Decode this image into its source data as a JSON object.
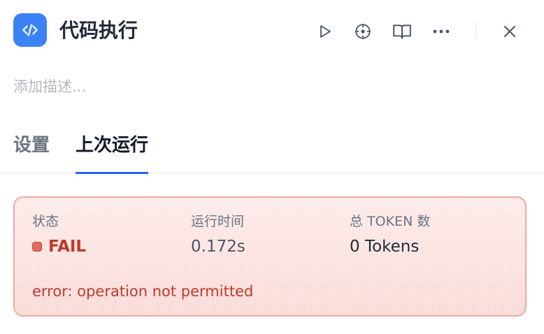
{
  "header": {
    "title": "代码执行",
    "icon": "code-icon",
    "actions": [
      "play-icon",
      "locate-icon",
      "book-icon",
      "more-icon",
      "close-icon"
    ]
  },
  "description_placeholder": "添加描述...",
  "tabs": [
    {
      "label": "设置",
      "active": false
    },
    {
      "label": "上次运行",
      "active": true
    }
  ],
  "run_result": {
    "status_label": "状态",
    "status_value": "FAIL",
    "time_label": "运行时间",
    "time_value": "0.172s",
    "tokens_label": "总 TOKEN 数",
    "tokens_value": "0 Tokens",
    "error": "error: operation not permitted"
  },
  "colors": {
    "accent": "#3b82f6",
    "tab_indicator": "#2563eb",
    "error": "#c0392b",
    "card_bg": "#fadcd9",
    "card_border": "#f1a9a2"
  }
}
